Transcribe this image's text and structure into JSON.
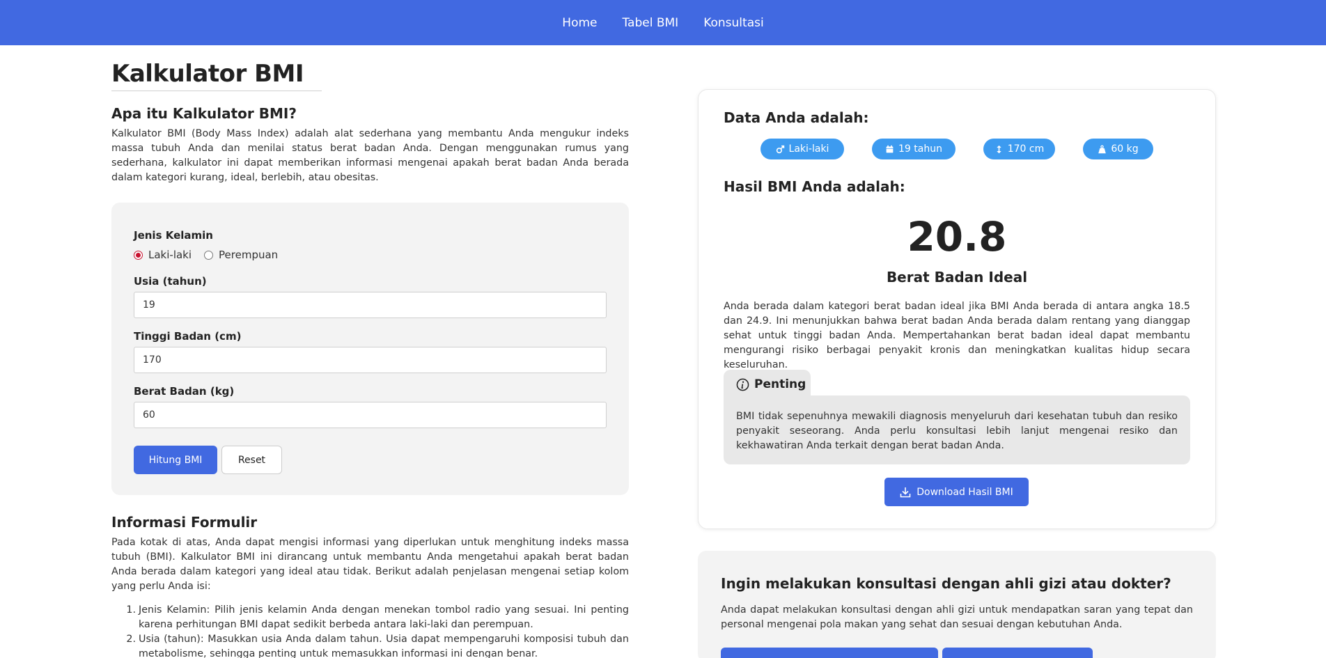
{
  "nav": {
    "items": [
      "Home",
      "Tabel BMI",
      "Konsultasi"
    ]
  },
  "page": {
    "title": "Kalkulator BMI"
  },
  "intro": {
    "heading": "Apa itu Kalkulator BMI?",
    "text": "Kalkulator BMI (Body Mass Index) adalah alat sederhana yang membantu Anda mengukur indeks massa tubuh Anda dan menilai status berat badan Anda. Dengan menggunakan rumus yang sederhana, kalkulator ini dapat memberikan informasi mengenai apakah berat badan Anda berada dalam kategori kurang, ideal, berlebih, atau obesitas."
  },
  "form": {
    "gender_label": "Jenis Kelamin",
    "gender_options": [
      "Laki-laki",
      "Perempuan"
    ],
    "gender_selected": "Laki-laki",
    "age_label": "Usia (tahun)",
    "age_value": "19",
    "height_label": "Tinggi Badan (cm)",
    "height_value": "170",
    "weight_label": "Berat Badan (kg)",
    "weight_value": "60",
    "submit_label": "Hitung BMI",
    "reset_label": "Reset"
  },
  "info": {
    "heading": "Informasi Formulir",
    "text": "Pada kotak di atas, Anda dapat mengisi informasi yang diperlukan untuk menghitung indeks massa tubuh (BMI). Kalkulator BMI ini dirancang untuk membantu Anda mengetahui apakah berat badan Anda berada dalam kategori yang ideal atau tidak. Berikut adalah penjelasan mengenai setiap kolom yang perlu Anda isi:",
    "items": [
      "Jenis Kelamin: Pilih jenis kelamin Anda dengan menekan tombol radio yang sesuai. Ini penting karena perhitungan BMI dapat sedikit berbeda antara laki-laki dan perempuan.",
      "Usia (tahun): Masukkan usia Anda dalam tahun. Usia dapat mempengaruhi komposisi tubuh dan metabolisme, sehingga penting untuk memasukkan informasi ini dengan benar."
    ]
  },
  "result": {
    "data_heading": "Data Anda adalah:",
    "pills": [
      {
        "icon": "male-icon",
        "label": "Laki-laki"
      },
      {
        "icon": "calendar-icon",
        "label": "19 tahun"
      },
      {
        "icon": "height-arrows-icon",
        "label": "170 cm"
      },
      {
        "icon": "weight-icon",
        "label": "60 kg"
      }
    ],
    "bmi_heading": "Hasil BMI Anda adalah:",
    "bmi_value": "20.8",
    "category": "Berat Badan Ideal",
    "description": "Anda berada dalam kategori berat badan ideal jika BMI Anda berada di antara angka 18.5 dan 24.9. Ini menunjukkan bahwa berat badan Anda berada dalam rentang yang dianggap sehat untuk tinggi badan Anda. Mempertahankan berat badan ideal dapat membantu mengurangi risiko berbagai penyakit kronis dan meningkatkan kualitas hidup secara keseluruhan.",
    "note_title": "Penting",
    "note_text": "BMI tidak sepenuhnya mewakili diagnosis menyeluruh dari kesehatan tubuh dan resiko penyakit seseorang. Anda perlu konsultasi lebih lanjut mengenai resiko dan kekhawatiran Anda terkait dengan berat badan Anda.",
    "download_label": "Download Hasil BMI"
  },
  "consult": {
    "heading": "Ingin melakukan konsultasi dengan ahli gizi atau dokter?",
    "text": "Anda dapat melakukan konsultasi dengan ahli gizi untuk mendapatkan saran yang tepat dan personal mengenai pola makan yang sehat dan sesuai dengan kebutuhan Anda."
  },
  "colors": {
    "primary": "#4169e1",
    "pill": "#3d9bf0",
    "card_bg": "#f3f3f3",
    "radio_selected": "#c8102e"
  }
}
